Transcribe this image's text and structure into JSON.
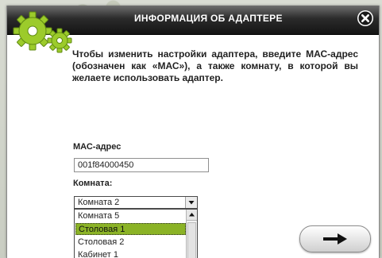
{
  "dialog": {
    "title": "ИНФОРМАЦИЯ ОБ АДАПТЕРЕ",
    "intro": "Чтобы изменить настройки адаптера, введите МАС-адрес (обозначен как «МАС»), а также комнату, в которой вы желаете использовать адаптер."
  },
  "form": {
    "mac_label": "МАС-адрес",
    "mac_value": "001f84000450",
    "room_label": "Комната:",
    "room_selected": "Комната 2",
    "room_options": [
      "Комната 5",
      "Столовая 1",
      "Столовая 2",
      "Кабинет 1"
    ],
    "highlighted_option": "Столовая 1"
  },
  "icons": {
    "close": "close-icon",
    "next": "arrow-right-icon",
    "logo": "gears-icon"
  },
  "colors": {
    "accent": "#8bb326",
    "gear": "#9ccb2b",
    "titlebar": "#1a1a1a"
  }
}
